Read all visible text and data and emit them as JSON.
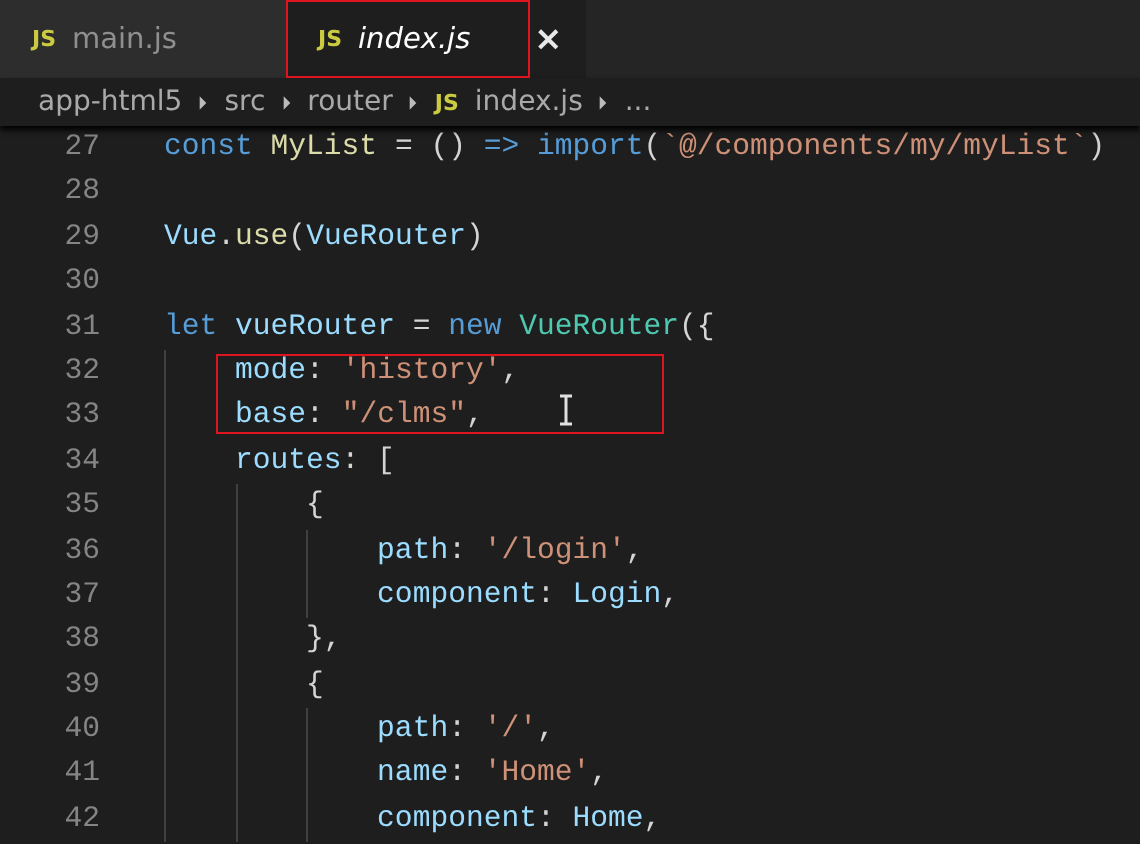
{
  "tabs": [
    {
      "icon": "JS",
      "label": "main.js",
      "selected": false,
      "marked": false
    },
    {
      "icon": "JS",
      "label": "index.js",
      "selected": true,
      "marked": true,
      "close": "×"
    }
  ],
  "breadcrumb": [
    {
      "label": "app-html5",
      "kind": "folder"
    },
    {
      "label": "src",
      "kind": "folder"
    },
    {
      "label": "router",
      "kind": "folder"
    },
    {
      "icon": "JS",
      "label": "index.js",
      "kind": "file"
    },
    {
      "label": "...",
      "kind": "more"
    }
  ],
  "code_lines": [
    {
      "number": "27",
      "marked": false,
      "tokens": [
        {
          "t": "const ",
          "kind": "keyword"
        },
        {
          "t": "MyList",
          "kind": "function"
        },
        {
          "t": " = () ",
          "kind": "plain"
        },
        {
          "t": "=> import",
          "kind": "keyword"
        },
        {
          "t": "(",
          "kind": "plain"
        },
        {
          "t": "`@/components/my/myList`",
          "kind": "string"
        },
        {
          "t": ")",
          "kind": "plain"
        }
      ]
    },
    {
      "number": "28"
    },
    {
      "number": "29",
      "marked": false,
      "tokens": [
        {
          "t": "Vue",
          "kind": "variable"
        },
        {
          "t": ".",
          "kind": "plain"
        },
        {
          "t": "use",
          "kind": "function"
        },
        {
          "t": "(",
          "kind": "plain"
        },
        {
          "t": "VueRouter",
          "kind": "variable"
        },
        {
          "t": ")",
          "kind": "plain"
        }
      ]
    },
    {
      "number": "30"
    },
    {
      "number": "31",
      "marked": false,
      "tokens": [
        {
          "t": "let ",
          "kind": "keyword"
        },
        {
          "t": "vueRouter",
          "kind": "variable"
        },
        {
          "t": " = ",
          "kind": "plain"
        },
        {
          "t": "new ",
          "kind": "keyword"
        },
        {
          "t": "VueRouter",
          "kind": "class"
        },
        {
          "t": "({",
          "kind": "plain"
        }
      ]
    },
    {
      "number": "32",
      "marked": true,
      "tokens": [
        {
          "t": "    mode",
          "kind": "variable"
        },
        {
          "t": ": ",
          "kind": "plain"
        },
        {
          "t": "'history'",
          "kind": "string"
        },
        {
          "t": ",",
          "kind": "plain"
        }
      ]
    },
    {
      "number": "33",
      "marked": true,
      "tokens": [
        {
          "t": "    base",
          "kind": "variable"
        },
        {
          "t": ": ",
          "kind": "plain"
        },
        {
          "t": "\"/clms\"",
          "kind": "string"
        },
        {
          "t": ",",
          "kind": "plain"
        }
      ]
    },
    {
      "number": "34",
      "marked": false,
      "tokens": [
        {
          "t": "    routes",
          "kind": "variable"
        },
        {
          "t": ": [",
          "kind": "plain"
        }
      ]
    },
    {
      "number": "35",
      "marked": false,
      "tokens": [
        {
          "t": "        {",
          "kind": "plain"
        }
      ]
    },
    {
      "number": "36",
      "marked": false,
      "tokens": [
        {
          "t": "            path",
          "kind": "variable"
        },
        {
          "t": ": ",
          "kind": "plain"
        },
        {
          "t": "'/login'",
          "kind": "string"
        },
        {
          "t": ",",
          "kind": "plain"
        }
      ]
    },
    {
      "number": "37",
      "marked": false,
      "tokens": [
        {
          "t": "            component",
          "kind": "variable"
        },
        {
          "t": ": ",
          "kind": "plain"
        },
        {
          "t": "Login",
          "kind": "variable"
        },
        {
          "t": ",",
          "kind": "plain"
        }
      ]
    },
    {
      "number": "38",
      "marked": false,
      "tokens": [
        {
          "t": "        },",
          "kind": "plain"
        }
      ]
    },
    {
      "number": "39",
      "marked": false,
      "tokens": [
        {
          "t": "        {",
          "kind": "plain"
        }
      ]
    },
    {
      "number": "40",
      "marked": false,
      "tokens": [
        {
          "t": "            path",
          "kind": "variable"
        },
        {
          "t": ": ",
          "kind": "plain"
        },
        {
          "t": "'/'",
          "kind": "string"
        },
        {
          "t": ",",
          "kind": "plain"
        }
      ]
    },
    {
      "number": "41",
      "marked": false,
      "tokens": [
        {
          "t": "            name",
          "kind": "variable"
        },
        {
          "t": ": ",
          "kind": "plain"
        },
        {
          "t": "'Home'",
          "kind": "string"
        },
        {
          "t": ",",
          "kind": "plain"
        }
      ]
    },
    {
      "number": "42",
      "marked": false,
      "tokens": [
        {
          "t": "            component",
          "kind": "variable"
        },
        {
          "t": ": ",
          "kind": "plain"
        },
        {
          "t": "Home",
          "kind": "variable"
        },
        {
          "t": ",",
          "kind": "plain"
        }
      ]
    }
  ]
}
